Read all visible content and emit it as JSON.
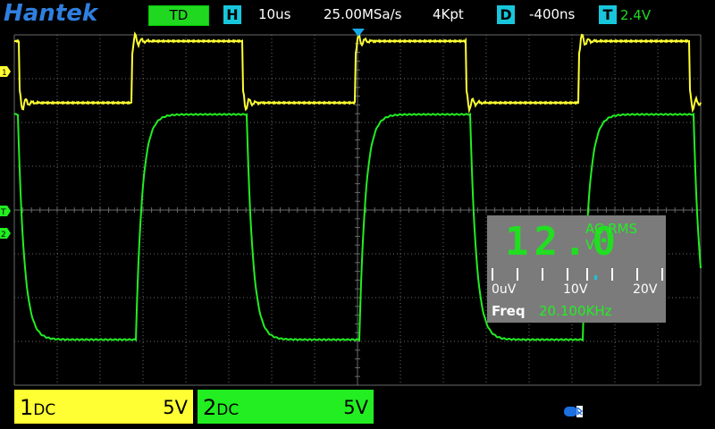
{
  "header": {
    "brand": "Hantek",
    "trigger_mode": "TD",
    "h_label": "H",
    "timebase": "10us",
    "sample_rate": "25.00MSa/s",
    "memory_depth": "4Kpt",
    "d_label": "D",
    "delay": "-400ns",
    "t_label": "T",
    "trigger_level": "2.4V"
  },
  "markers": {
    "ch1": "1",
    "trig": "T",
    "ch2": "2"
  },
  "channels": [
    {
      "number": "1",
      "coupling": "DC",
      "scale": "5V"
    },
    {
      "number": "2",
      "coupling": "DC",
      "scale": "5V"
    }
  ],
  "measurement": {
    "reading": "12.0",
    "mode": "AC RMS",
    "unit": "V",
    "scale_labels": [
      "0uV",
      "10V",
      "20V"
    ],
    "freq_label": "Freq",
    "freq_value": "20.100KHz"
  },
  "colors": {
    "ch1": "#ffff33",
    "ch2": "#22ee22",
    "grid": "#6a6a6a",
    "accent": "#18c6dc"
  }
}
